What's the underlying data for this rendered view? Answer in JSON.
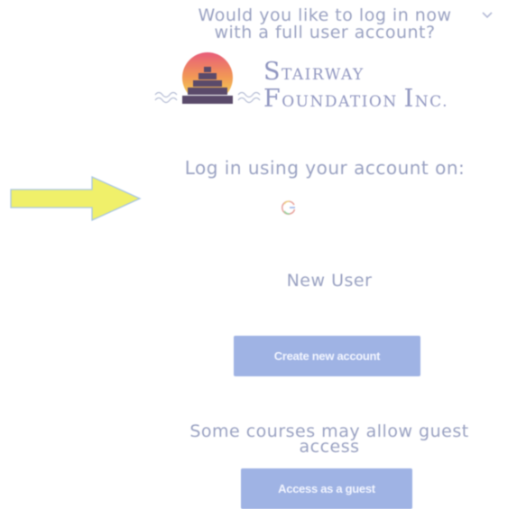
{
  "prompt": {
    "title_line_1": "Would you like to log in now",
    "title_line_2": "with a full user account?"
  },
  "collapse": {
    "icon": "chevron-down-icon"
  },
  "brand": {
    "line_1_initial": "S",
    "line_1_rest": "TAIRWAY",
    "line_2_initial_1": "F",
    "line_2_rest_1": "OUNDATION ",
    "line_2_initial_2": "I",
    "line_2_rest_2": "NC.",
    "logo_icon": "stairway-sunset-logo-icon"
  },
  "login": {
    "heading": "Log in using your account on:",
    "provider_icon": "google-icon"
  },
  "annotation": {
    "arrow_icon": "yellow-arrow-icon",
    "arrow_color": "#f0f06a"
  },
  "new_user": {
    "heading": "New User",
    "create_button_label": "Create new account"
  },
  "guest": {
    "heading_line_1": "Some courses may allow guest",
    "heading_line_2": "access",
    "button_label": "Access as a guest"
  },
  "colors": {
    "text": "#9aa2c2",
    "button": "#9fb3e4",
    "button_text": "#f2f5ff"
  }
}
